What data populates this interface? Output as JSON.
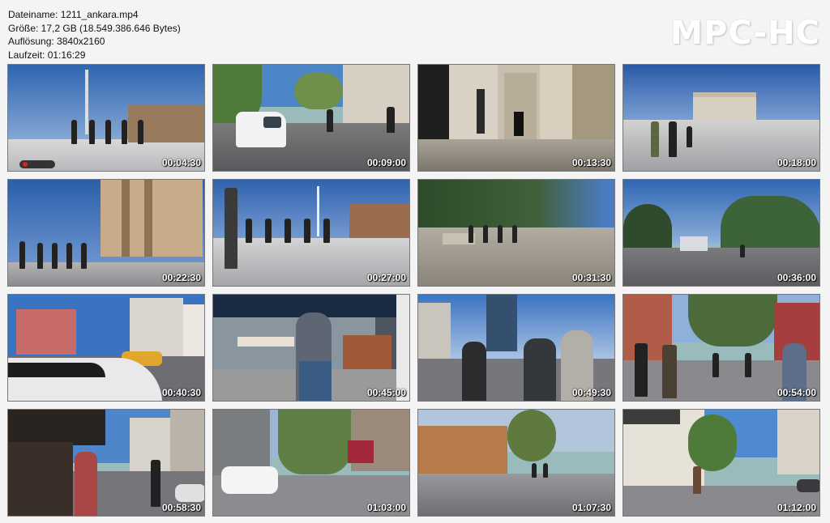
{
  "info": {
    "filename": "Dateiname: 1211_ankara.mp4",
    "size": "Größe: 17,2 GB (18.549.386.646 Bytes)",
    "resolution": "Auflösung: 3840x2160",
    "duration": "Laufzeit: 01:16:29"
  },
  "logo": "MPC-HC",
  "thumbnails": [
    {
      "time": "00:04:30"
    },
    {
      "time": "00:09:00"
    },
    {
      "time": "00:13:30"
    },
    {
      "time": "00:18:00"
    },
    {
      "time": "00:22:30"
    },
    {
      "time": "00:27:00"
    },
    {
      "time": "00:31:30"
    },
    {
      "time": "00:36:00"
    },
    {
      "time": "00:40:30"
    },
    {
      "time": "00:45:00"
    },
    {
      "time": "00:49:30"
    },
    {
      "time": "00:54:00"
    },
    {
      "time": "00:58:30"
    },
    {
      "time": "01:03:00"
    },
    {
      "time": "01:07:30"
    },
    {
      "time": "01:12:00"
    }
  ],
  "colors": {
    "background": "#f4f4f4",
    "sky_blue": "#3d6fb3",
    "stone": "#c9c2b6",
    "pavement": "#8f8f93"
  }
}
